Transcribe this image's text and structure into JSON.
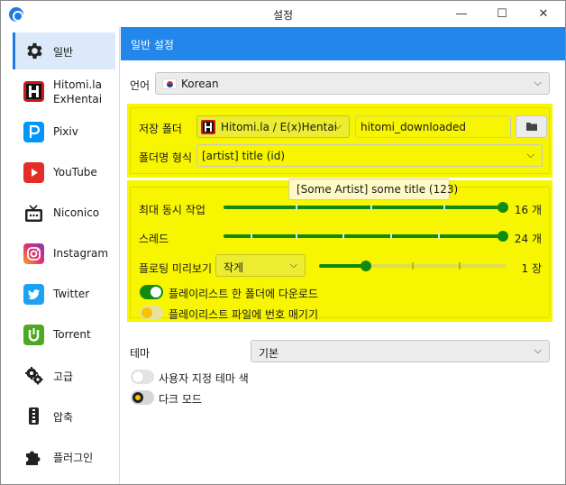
{
  "window": {
    "title": "설정",
    "controls": {
      "minimize": "—",
      "maximize": "☐",
      "close": "✕"
    }
  },
  "sidebar": {
    "items": [
      {
        "label": "일반",
        "icon": "gear-icon"
      },
      {
        "label": "Hitomi.la ExHentai",
        "icon": "hitomi-icon"
      },
      {
        "label": "Pixiv",
        "icon": "pixiv-icon"
      },
      {
        "label": "YouTube",
        "icon": "youtube-icon"
      },
      {
        "label": "Niconico",
        "icon": "niconico-icon"
      },
      {
        "label": "Instagram",
        "icon": "instagram-icon"
      },
      {
        "label": "Twitter",
        "icon": "twitter-icon"
      },
      {
        "label": "Torrent",
        "icon": "torrent-icon"
      },
      {
        "label": "고급",
        "icon": "gears-icon"
      },
      {
        "label": "압축",
        "icon": "zip-icon"
      },
      {
        "label": "플러그인",
        "icon": "puzzle-icon"
      }
    ]
  },
  "header": {
    "title": "일반 설정"
  },
  "language": {
    "label": "언어",
    "value": "Korean",
    "flag": "korea-flag-icon"
  },
  "save_folder": {
    "label": "저장 폴더",
    "site_value": "Hitomi.la / E(x)Hentai",
    "path_value": "hitomi_downloaded"
  },
  "folder_format": {
    "label": "폴더명 형식",
    "value": "[artist] title (id)",
    "tooltip": "[Some Artist] some title (123)"
  },
  "concurrent": {
    "label": "최대 동시 작업",
    "value": "16 개",
    "level": 1.0
  },
  "threads": {
    "label": "스레드",
    "value": "24 개",
    "level": 1.0
  },
  "floating_preview": {
    "label": "플로팅 미리보기",
    "size_value": "작게",
    "value": "1 장",
    "level": 0.25
  },
  "playlist_one_folder": {
    "label": "플레이리스트 한 폴더에 다운로드",
    "checked": true
  },
  "playlist_numbering": {
    "label": "플레이리스트 파일에 번호 매기기",
    "checked": false
  },
  "theme": {
    "label": "테마",
    "value": "기본"
  },
  "custom_theme_color": {
    "label": "사용자 지정 테마 색",
    "checked": false
  },
  "dark_mode": {
    "label": "다크 모드",
    "checked": false
  },
  "colors": {
    "accent": "#2386ea",
    "highlight": "#f7f500",
    "slider": "#108a10"
  }
}
